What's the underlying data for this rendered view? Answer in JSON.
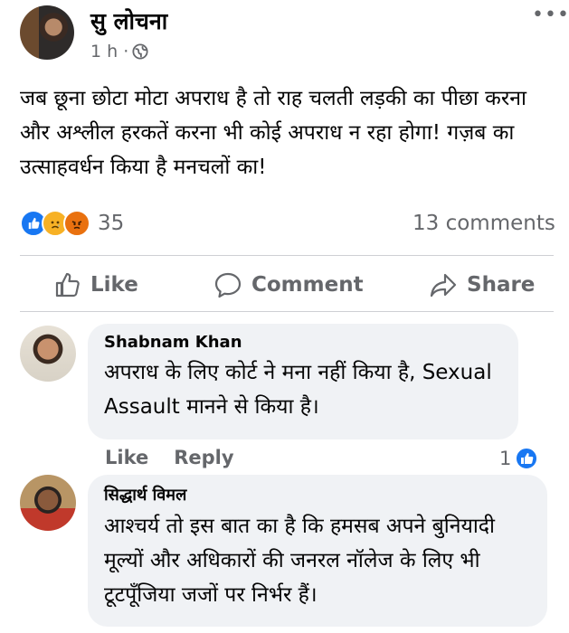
{
  "post": {
    "author": "सु लोचना",
    "time": "1 h ·",
    "more": "•••",
    "text": "जब छूना छोटा मोटा अपराध  है तो राह चलती लड़की का पीछा करना और अश्लील हरकतें करना भी कोई अपराध न रहा होगा! गज़ब का उत्साहवर्धन किया है मनचलों का!",
    "reaction_count": "35",
    "comment_count": "13 comments",
    "reaction_icons": [
      "like-icon",
      "sad-icon",
      "angry-icon"
    ]
  },
  "actions": {
    "like": "Like",
    "comment": "Comment",
    "share": "Share"
  },
  "comments": [
    {
      "name": "Shabnam Khan",
      "text": "अपराध के लिए कोर्ट ने मना नहीं किया है, Sexual Assault मानने से किया है।",
      "like_label": "Like",
      "reply_label": "Reply",
      "like_count": "1"
    },
    {
      "name": "सिद्धार्थ विमल",
      "text": "आश्चर्य तो इस बात का है कि हमसब अपने बुनियादी मूल्यों और अधिकारों की जनरल नॉलेज के लिए भी टूटपूँजिया जजों पर निर्भर हैं।"
    }
  ],
  "colors": {
    "fb_blue": "#1877f2",
    "secondary_text": "#65676b",
    "bubble_bg": "#f0f2f5"
  }
}
